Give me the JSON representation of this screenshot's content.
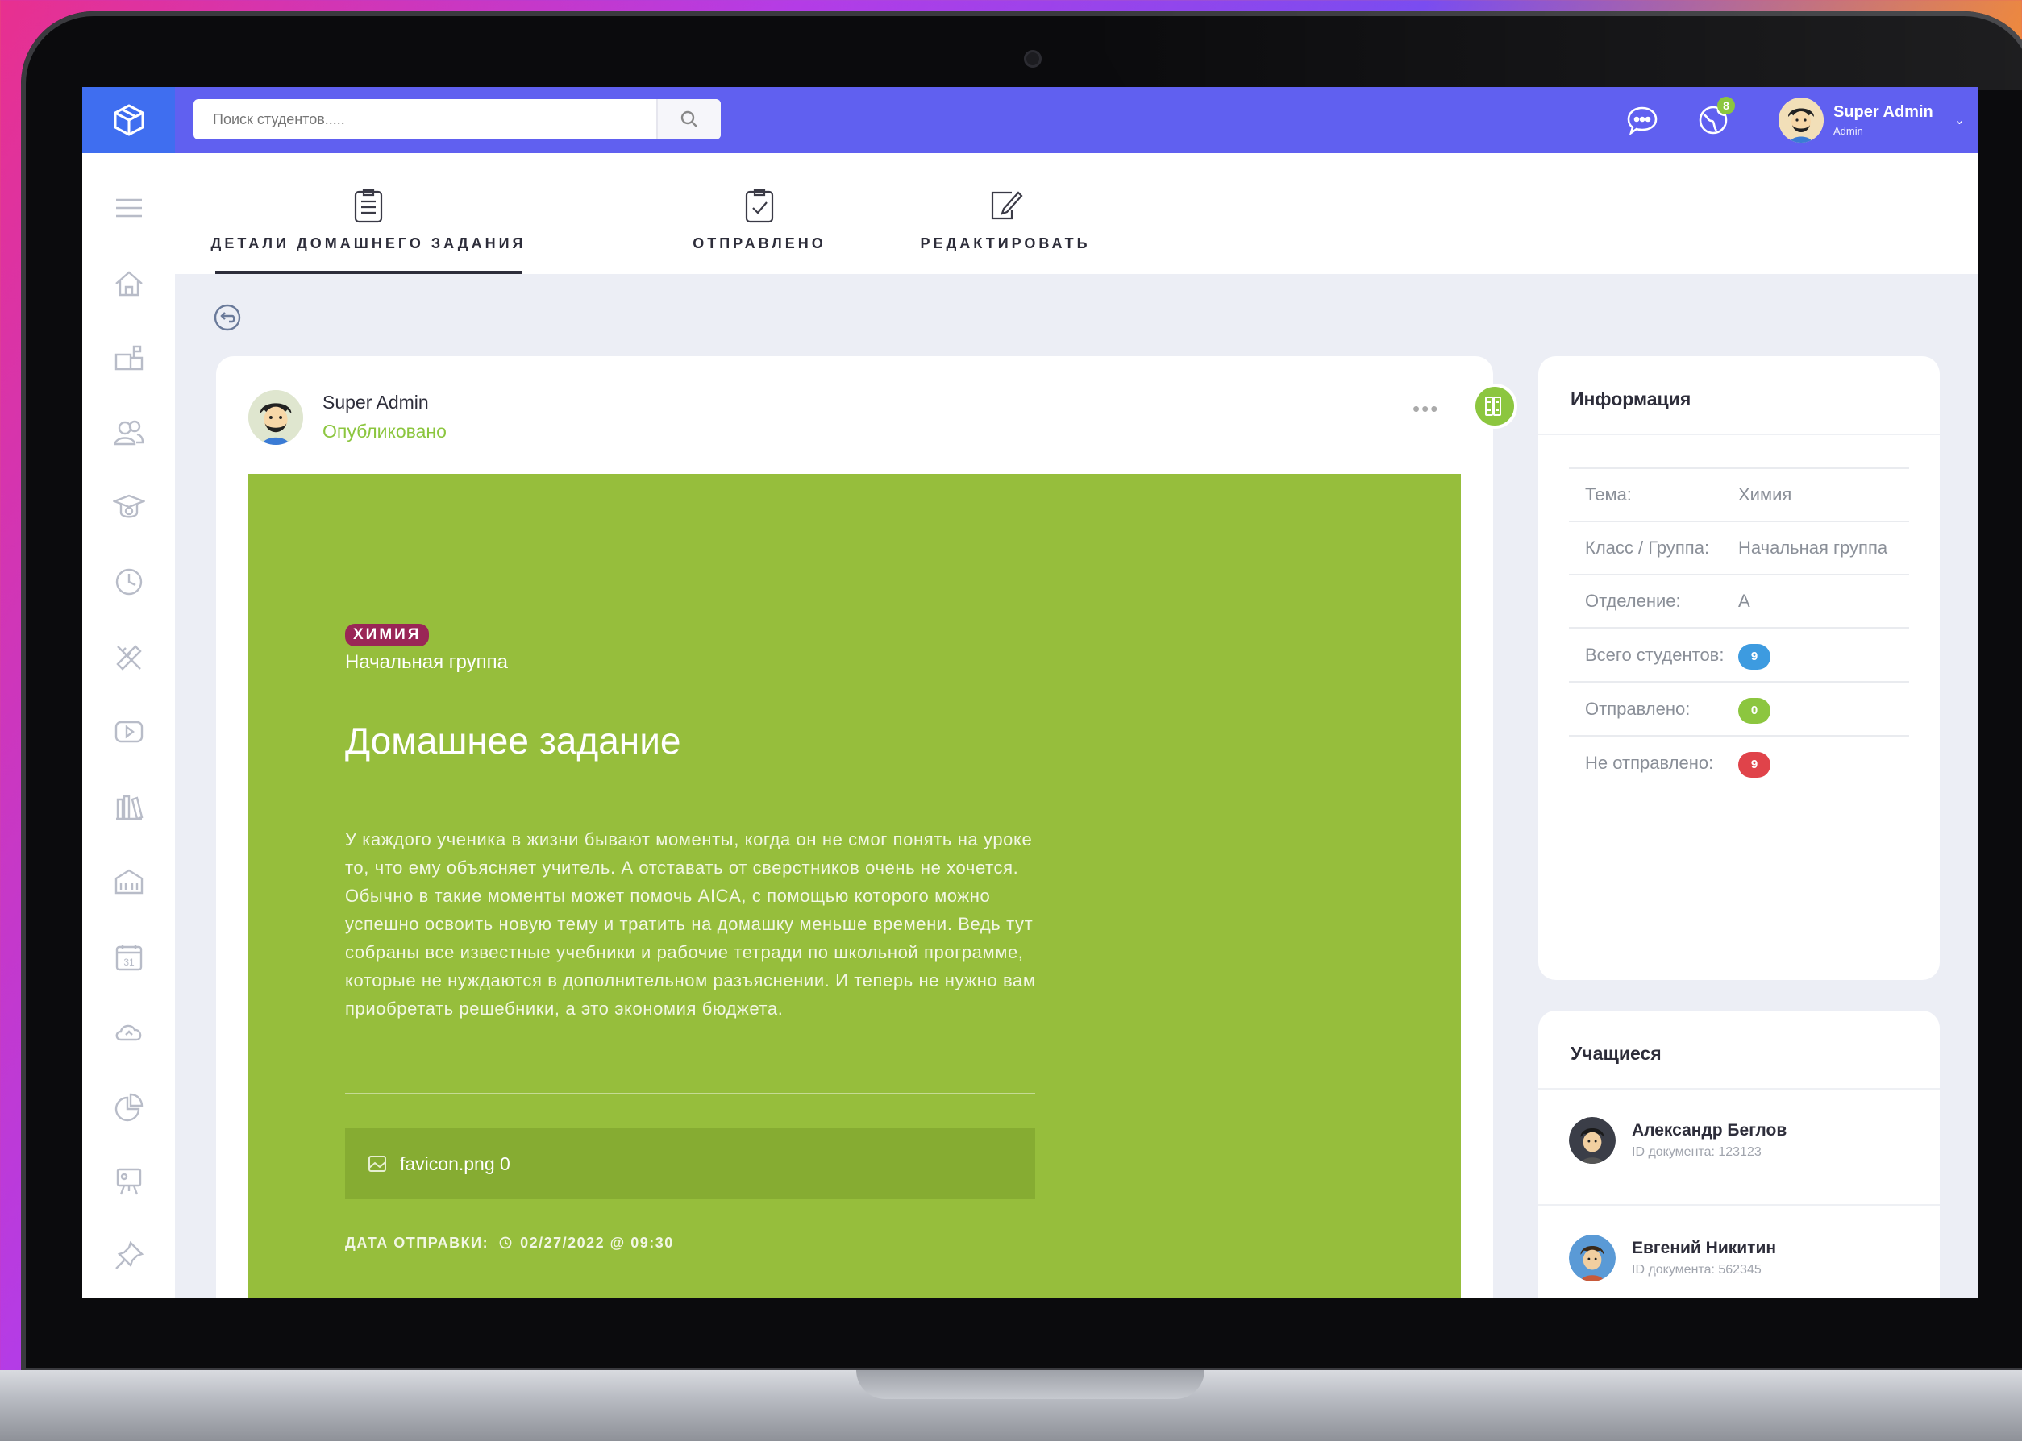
{
  "colors": {
    "topbar": "#6060f0",
    "logo_bg": "#3f6ef0",
    "panel_green": "#96be3c",
    "accent_green": "#8cc63f",
    "subject_pill": "#9a2656",
    "badge_blue": "#3d9be0",
    "badge_red": "#e0434a"
  },
  "topbar": {
    "logo_icon": "cube-logo-icon",
    "search_placeholder": "Поиск студентов.....",
    "search_icon": "search-icon",
    "chat_icon": "chat-icon",
    "globe_icon": "globe-icon",
    "notification_count": "8",
    "user_name": "Super Admin",
    "user_role": "Admin",
    "chevron": "⌄"
  },
  "sidebar": {
    "items": [
      "menu-icon",
      "home-icon",
      "mailbox-icon",
      "users-icon",
      "graduation-icon",
      "clock-icon",
      "ruler-pencil-icon",
      "video-icon",
      "library-icon",
      "school-icon",
      "calendar-icon",
      "cloud-icon",
      "chart-icon",
      "presentation-icon",
      "pin-icon"
    ],
    "calendar_day": "31"
  },
  "tabs": [
    {
      "label": "ДЕТАЛИ ДОМАШНЕГО ЗАДАНИЯ",
      "icon": "clipboard-list-icon",
      "active": true
    },
    {
      "label": "ОТПРАВЛЕНО",
      "icon": "clipboard-check-icon",
      "active": false
    },
    {
      "label": "РЕДАКТИРОВАТЬ",
      "icon": "edit-icon",
      "active": false
    }
  ],
  "post": {
    "author": "Super Admin",
    "status": "Опубликовано",
    "more": "•••",
    "subject": "ХИМИЯ",
    "group": "Начальная группа",
    "title": "Домашнее задание",
    "body": "У каждого ученика в жизни бывают моменты, когда он не смог понять на уроке то, что ему объясняет учитель. А отставать от сверстников очень не хочется. Обычно в такие моменты может помочь AICA, с помощью которого можно успешно освоить новую тему и тратить на домашку меньше времени. Ведь тут собраны все известные учебники и рабочие тетради по школьной программе, которые не нуждаются в дополнительном разъяснении. И теперь не нужно вам приобретать решебники, а это экономия бюджета.",
    "attachment": "favicon.png 0",
    "sent_label": "ДАТА ОТПРАВКИ:",
    "sent_value": "02/27/2022 @ 09:30"
  },
  "info": {
    "title": "Информация",
    "rows": [
      {
        "label": "Тема:",
        "value": "Химия"
      },
      {
        "label": "Класс / Группа:",
        "value": "Начальная группа"
      },
      {
        "label": "Отделение:",
        "value": "A"
      },
      {
        "label": "Всего студентов:",
        "value": "9"
      },
      {
        "label": "Отправлено:",
        "value": "0"
      },
      {
        "label": "Не отправлено:",
        "value": "9"
      }
    ]
  },
  "students": {
    "title": "Учащиеся",
    "items": [
      {
        "name": "Александр Беглов",
        "doc": "ID документа: 123123"
      },
      {
        "name": "Евгений Никитин",
        "doc": "ID документа: 562345"
      }
    ]
  }
}
